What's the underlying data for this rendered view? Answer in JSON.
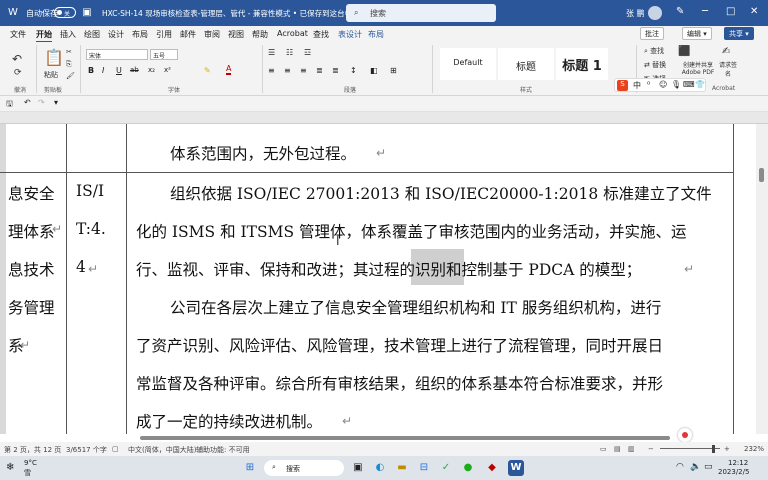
{
  "titlebar": {
    "autosave_label": "自动保存",
    "autosave_state": "关",
    "doc_title": "HXC-SH-14 现场审核检查表-管理层、管代 - 兼容性模式 • 已保存到这台电脑",
    "search_placeholder": "搜索",
    "user_name": "张 鹏"
  },
  "menu": {
    "items": [
      "文件",
      "开始",
      "插入",
      "绘图",
      "设计",
      "布局",
      "引用",
      "邮件",
      "审阅",
      "视图",
      "帮助",
      "Acrobat",
      "查找",
      "表设计",
      "布局"
    ],
    "comment_btn": "批注",
    "edit_btn": "编辑",
    "share_btn": "共享"
  },
  "ribbon": {
    "paste": "粘贴",
    "font_name": "宋体",
    "font_size": "五号",
    "groups": {
      "undo": "撤消",
      "clipboard": "剪贴板",
      "font": "字体",
      "paragraph": "段落",
      "styles": "样式",
      "acrobat": "Acrobat"
    },
    "styles": [
      "Default",
      "标题",
      "标题 1"
    ],
    "find": "查找",
    "replace": "替换",
    "select": "选择",
    "create_pdf": "创建并共享 Adobe PDF",
    "request_sign": "请求签名",
    "format_buttons": [
      "B",
      "I",
      "U",
      "ab",
      "x₂",
      "x²",
      "A"
    ]
  },
  "document": {
    "col1_lines": [
      "息安全",
      "理体系",
      "息技术",
      "务管理",
      "系"
    ],
    "col2_lines": [
      "IS/I",
      "T:4.",
      "4"
    ],
    "para0": "体系范围内，无外包过程。",
    "para1": [
      "组织依据 ISO/IEC 27001:2013 和 ISO/IEC20000-1:2018 标准建立了文件",
      "化的 ISMS 和 ITSMS 管理体，体系覆盖了审核范围内的业务活动，并实施、运",
      "行、监视、评审、保持和改进；其过程的识别和控制基于 PDCA 的模型；"
    ],
    "para2": [
      "公司在各层次上建立了信息安全管理组织机构和 IT 服务组织机构，进行",
      "了资产识别、风险评估、风险管理，技术管理上进行了流程管理，同时开展日",
      "常监督及各种评审。综合所有审核结果，组织的体系基本符合标准要求，并形",
      "成了一定的持续改进机制。"
    ]
  },
  "statusbar": {
    "page": "第 2 页，共 12 页",
    "words": "3/6517 个字",
    "lang": "中文(简体，中国大陆)",
    "access": "辅助功能: 不可用",
    "zoom": "232%"
  },
  "taskbar": {
    "weather_temp": "9°C",
    "weather_desc": "雪",
    "search": "搜索",
    "time": "12:12",
    "date": "2023/2/5"
  }
}
